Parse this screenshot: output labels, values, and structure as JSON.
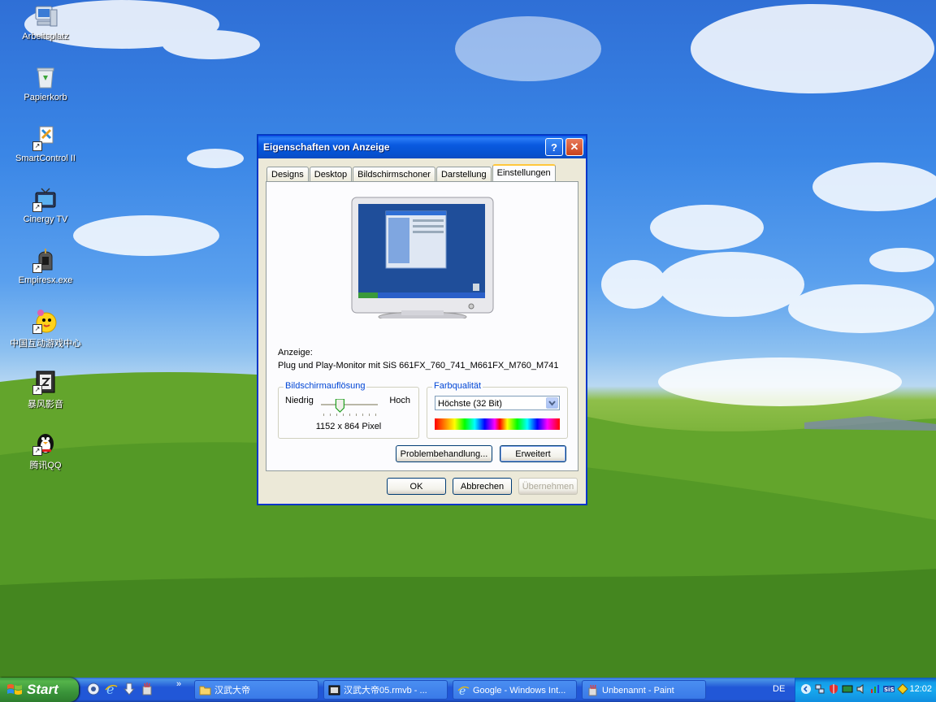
{
  "desktop": {
    "icons": [
      {
        "label": "Arbeitsplatz"
      },
      {
        "label": "Papierkorb"
      },
      {
        "label": "SmartControl II"
      },
      {
        "label": "Cinergy TV"
      },
      {
        "label": "Empiresx.exe"
      },
      {
        "label": "中国互动游戏中心"
      },
      {
        "label": "暴风影音"
      },
      {
        "label": "腾讯QQ"
      }
    ]
  },
  "dialog": {
    "title": "Eigenschaften von Anzeige",
    "help_glyph": "?",
    "close_glyph": "✕",
    "tabs": [
      {
        "label": "Designs"
      },
      {
        "label": "Desktop"
      },
      {
        "label": "Bildschirmschoner"
      },
      {
        "label": "Darstellung"
      },
      {
        "label": "Einstellungen"
      }
    ],
    "active_tab": "Einstellungen",
    "display_label": "Anzeige:",
    "display_device": "Plug und Play-Monitor mit SiS 661FX_760_741_M661FX_M760_M741",
    "resolution": {
      "group_title": "Bildschirmauflösung",
      "low_label": "Niedrig",
      "high_label": "Hoch",
      "value": "1152 x 864 Pixel",
      "slider_fraction": 0.3
    },
    "color": {
      "group_title": "Farbqualität",
      "selected": "Höchste (32 Bit)"
    },
    "buttons": {
      "troubleshoot": "Problembehandlung...",
      "advanced": "Erweitert",
      "ok": "OK",
      "cancel": "Abbrechen",
      "apply": "Übernehmen"
    }
  },
  "taskbar": {
    "start_label": "Start",
    "more_glyph": "»",
    "tasks": [
      {
        "label": "汉武大帝"
      },
      {
        "label": "汉武大帝05.rmvb - ..."
      },
      {
        "label": "Google - Windows Int..."
      },
      {
        "label": "Unbenannt - Paint"
      }
    ],
    "language": "DE",
    "clock": "12:02"
  },
  "colors": {
    "title_blue": "#0a5ae0",
    "start_green": "#3a943a",
    "taskbar_blue": "#2157d7",
    "dialog_bg": "#ece9d8",
    "group_title_blue": "#0046d5"
  }
}
